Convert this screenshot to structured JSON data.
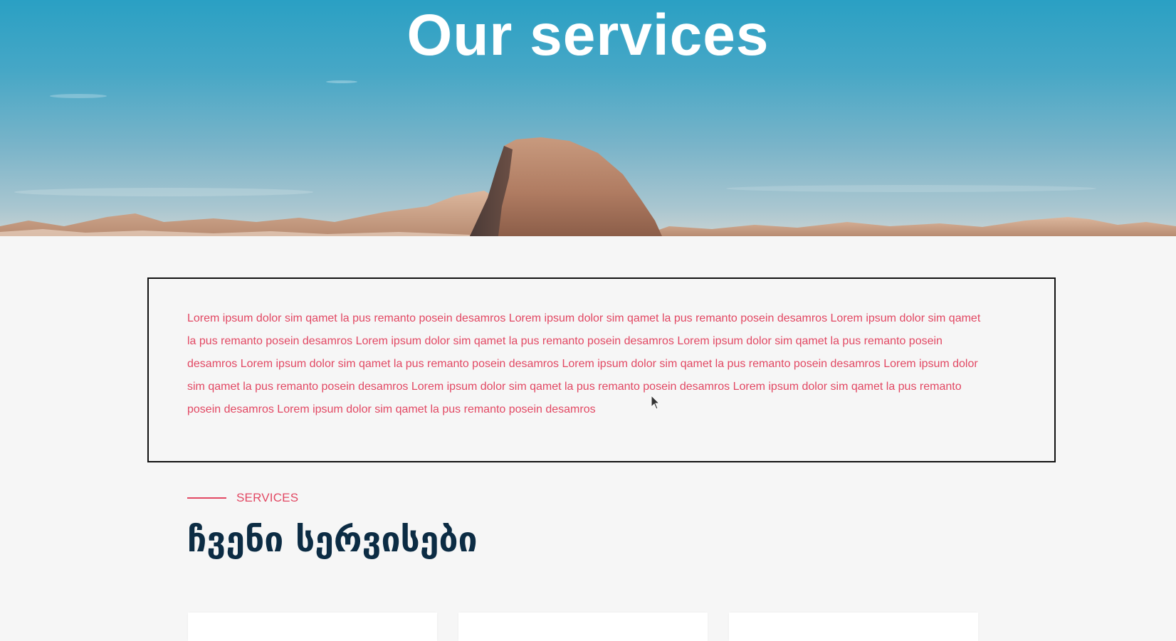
{
  "hero": {
    "title": "Our services",
    "background_image": "mountain-landscape"
  },
  "intro": {
    "text": "Lorem ipsum dolor sim qamet la pus remanto posein desamros Lorem ipsum dolor sim qamet la pus remanto posein desamros Lorem ipsum dolor sim qamet la pus remanto posein desamros Lorem ipsum dolor sim qamet la pus remanto posein desamros Lorem ipsum dolor sim qamet la pus remanto posein desamros Lorem ipsum dolor sim qamet la pus remanto posein desamros Lorem ipsum dolor sim qamet la pus remanto posein desamros Lorem ipsum dolor sim qamet la pus remanto posein desamros Lorem ipsum dolor sim qamet la pus remanto posein desamros Lorem ipsum dolor sim qamet la pus remanto posein desamros Lorem ipsum dolor sim qamet la pus remanto posein desamros"
  },
  "services": {
    "eyebrow": "SERVICES",
    "heading": "ჩვენი სერვისები",
    "cards": [
      {
        "id": "card-1"
      },
      {
        "id": "card-2"
      },
      {
        "id": "card-3"
      }
    ]
  },
  "colors": {
    "accent": "#e24863",
    "heading": "#0c2c44",
    "page_background": "#f6f6f6",
    "box_border": "#111111"
  }
}
